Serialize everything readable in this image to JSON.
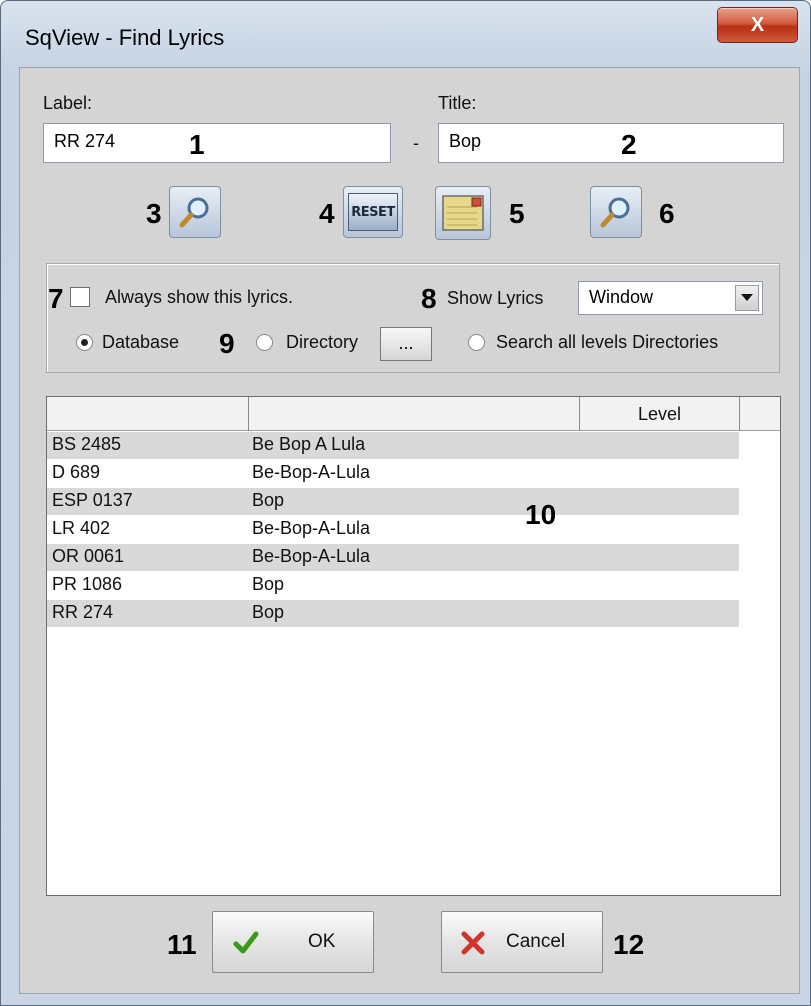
{
  "window": {
    "title": "SqView - Find Lyrics",
    "close_label": "X"
  },
  "fields": {
    "label_caption": "Label:",
    "label_value": "RR 274",
    "separator": "-",
    "title_caption": "Title:",
    "title_value": "Bop"
  },
  "toolbar": {
    "reset_label": "RESET"
  },
  "options": {
    "always_show_label": "Always show this lyrics.",
    "always_show_checked": false,
    "show_lyrics_label": "Show Lyrics",
    "show_lyrics_value": "Window",
    "source_database": "Database",
    "source_directory": "Directory",
    "browse_label": "...",
    "source_search_all": "Search all levels Directories",
    "selected_source": "Database"
  },
  "list": {
    "columns": [
      "",
      "",
      "Level"
    ],
    "rows": [
      {
        "label": "BS 2485",
        "title": "Be Bop A Lula"
      },
      {
        "label": "D 689",
        "title": "Be-Bop-A-Lula"
      },
      {
        "label": "ESP 0137",
        "title": "Bop"
      },
      {
        "label": "LR 402",
        "title": "Be-Bop-A-Lula"
      },
      {
        "label": "OR 0061",
        "title": "Be-Bop-A-Lula"
      },
      {
        "label": "PR 1086",
        "title": "Bop"
      },
      {
        "label": "RR 274",
        "title": "Bop"
      }
    ]
  },
  "buttons": {
    "ok_label": "OK",
    "cancel_label": "Cancel"
  },
  "callouts": [
    "1",
    "2",
    "3",
    "4",
    "5",
    "6",
    "7",
    "8",
    "9",
    "10",
    "11",
    "12"
  ],
  "colors": {
    "titlebar": "#c6d3e3",
    "close": "#c8442a",
    "row_alt": "#d9d9d9",
    "ok_check": "#3a9a1a",
    "cancel_x": "#d0342c"
  }
}
